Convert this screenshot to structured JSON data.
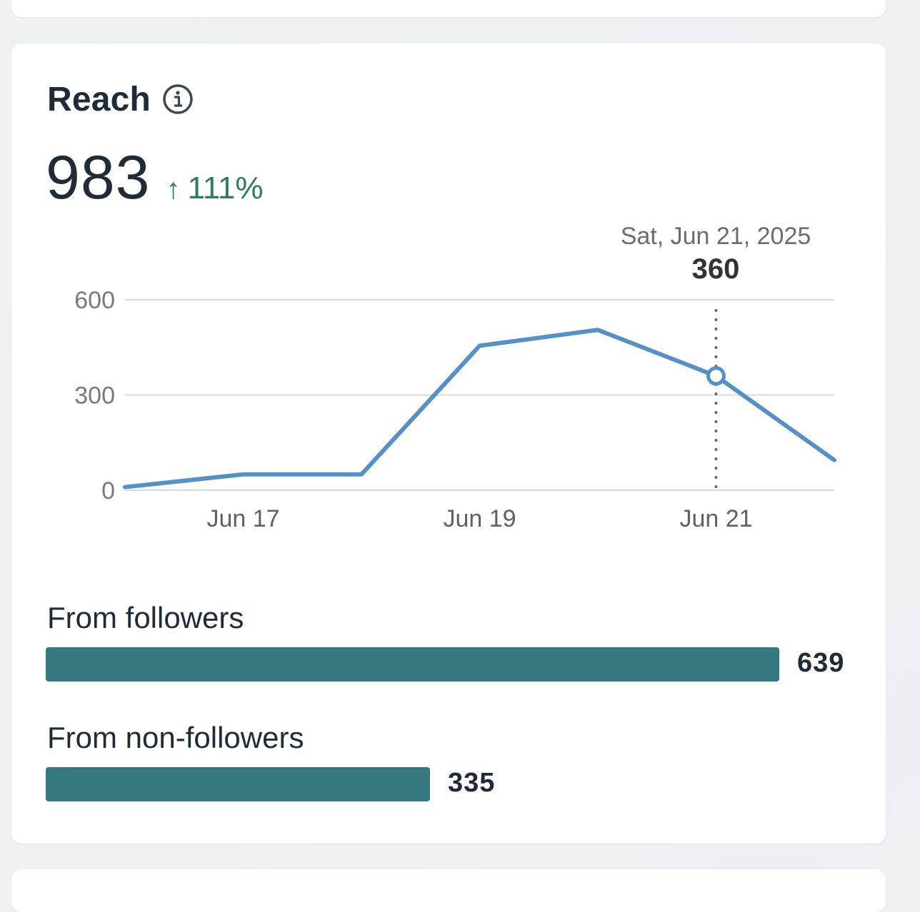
{
  "card": {
    "title": "Reach",
    "value": "983",
    "change": "111%",
    "change_direction": "up",
    "change_color": "#2e7d5b"
  },
  "tooltip": {
    "date": "Sat, Jun 21, 2025",
    "value": "360"
  },
  "chart_data": {
    "type": "line",
    "title": "",
    "xlabel": "",
    "ylabel": "",
    "x": [
      "Jun 16",
      "Jun 17",
      "Jun 18",
      "Jun 19",
      "Jun 20",
      "Jun 21",
      "Jun 22"
    ],
    "x_tick_labels": [
      "Jun 17",
      "Jun 19",
      "Jun 21"
    ],
    "y_ticks": [
      0,
      300,
      600
    ],
    "ylim": [
      0,
      600
    ],
    "grid": true,
    "series": [
      {
        "values": [
          10,
          50,
          50,
          455,
          505,
          360,
          95
        ],
        "color": "#5590c6"
      }
    ],
    "highlight": {
      "x": "Jun 21",
      "value": 360
    }
  },
  "breakdown": [
    {
      "label": "From followers",
      "value": 639,
      "display": "639"
    },
    {
      "label": "From non-followers",
      "value": 335,
      "display": "335"
    }
  ],
  "colors": {
    "bar": "#367880",
    "line": "#5590c6",
    "text": "#1f2b36"
  }
}
